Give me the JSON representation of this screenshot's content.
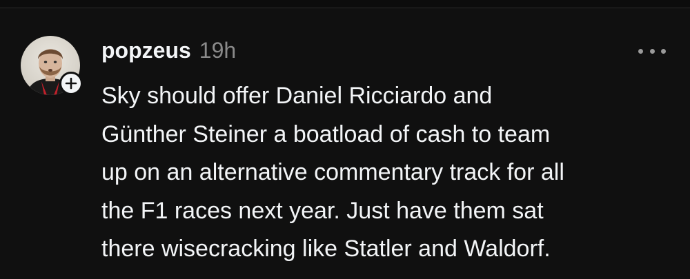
{
  "post": {
    "username": "popzeus",
    "timestamp": "19h",
    "body_lines": [
      "Sky should offer Daniel Ricciardo and",
      "Günther Steiner a boatload of cash to team",
      "up on an alternative commentary track for all",
      "the F1 races next year. Just have them sat",
      "there wisecracking like Statler and Waldorf."
    ],
    "avatar_icon": "user-avatar",
    "follow_icon": "plus-icon",
    "more_icon": "ellipsis-icon"
  },
  "colors": {
    "background": "#101010",
    "text_primary": "#f3f5f7",
    "text_secondary": "#8a8a8a"
  }
}
